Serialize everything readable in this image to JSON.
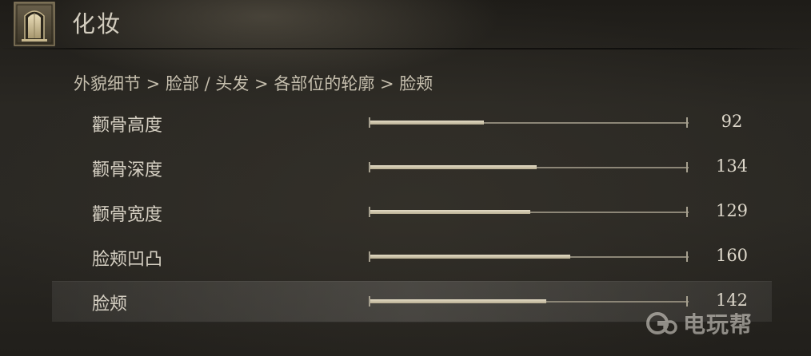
{
  "header": {
    "title": "化妆",
    "emblem_icon": "doorway-emblem-icon"
  },
  "breadcrumb": {
    "text": "外貌细节 > 脸部 / 头发 > 各部位的轮廓 > 脸颊"
  },
  "sliders": [
    {
      "label": "颧骨高度",
      "value": "92",
      "level": 0.36,
      "selected": false
    },
    {
      "label": "颧骨深度",
      "value": "134",
      "level": 0.525,
      "selected": false
    },
    {
      "label": "颧骨宽度",
      "value": "129",
      "level": 0.505,
      "selected": false
    },
    {
      "label": "脸颊凹凸",
      "value": "160",
      "level": 0.63,
      "selected": false
    },
    {
      "label": "脸颊",
      "value": "142",
      "level": 0.555,
      "selected": true
    }
  ],
  "watermark": {
    "text": "电玩帮",
    "icon": "controller-logo-icon"
  }
}
